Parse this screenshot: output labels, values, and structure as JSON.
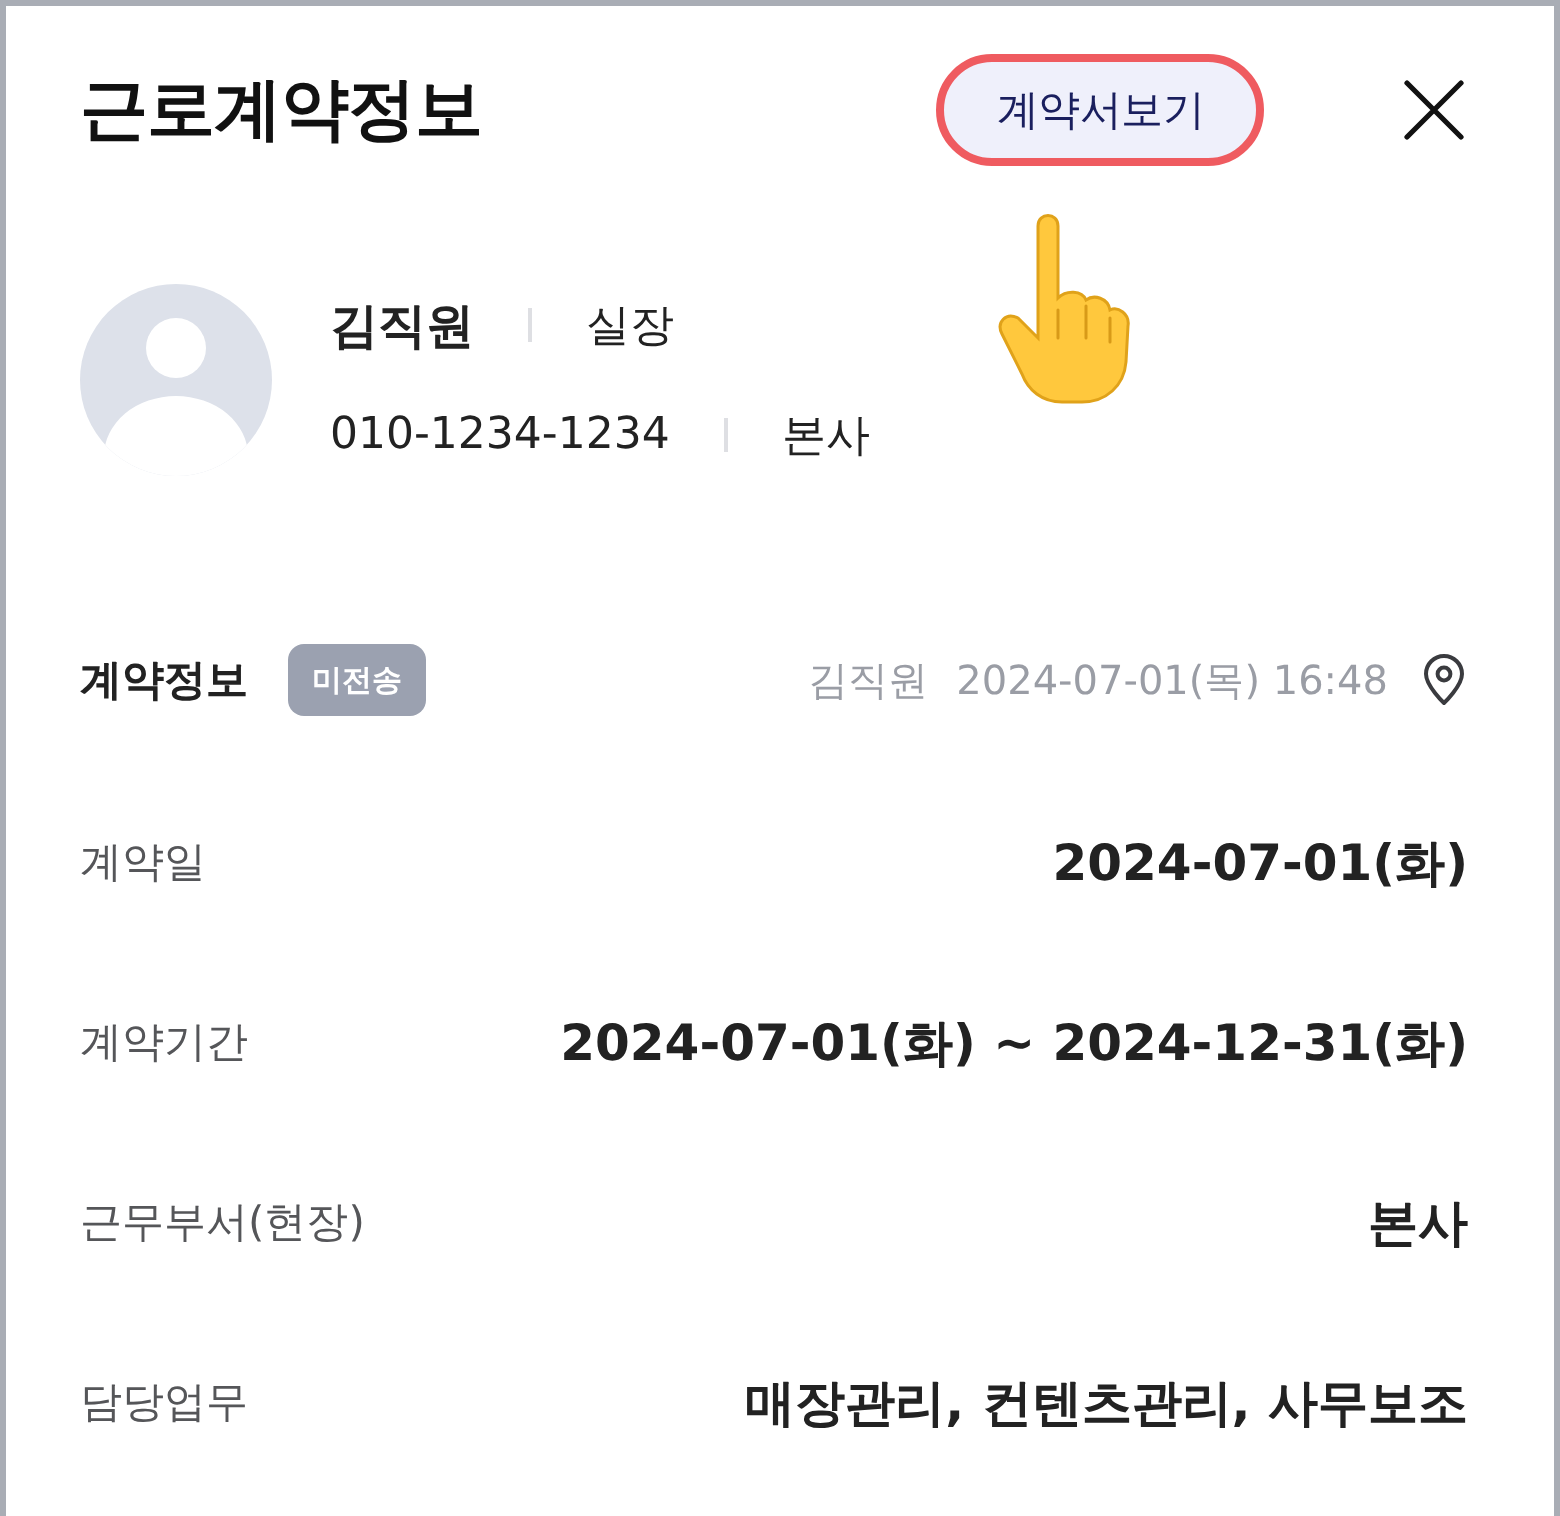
{
  "header": {
    "title": "근로계약정보",
    "view_button": {
      "label": "계약서보기",
      "highlighted": true
    }
  },
  "profile": {
    "name": "김직원",
    "position": "실장",
    "phone": "010-1234-1234",
    "branch": "본사"
  },
  "contract": {
    "title": "계약정보",
    "status_badge": "미전송",
    "author": "김직원",
    "timestamp": "2024-07-01(목) 16:48",
    "rows": [
      {
        "label": "계약일",
        "value": "2024-07-01(화)"
      },
      {
        "label": "계약기간",
        "value": "2024-07-01(화) ~ 2024-12-31(화)"
      },
      {
        "label": "근무부서(현장)",
        "value": "본사"
      },
      {
        "label": "담당업무",
        "value": "매장관리, 컨텐츠관리, 사무보조"
      }
    ]
  }
}
